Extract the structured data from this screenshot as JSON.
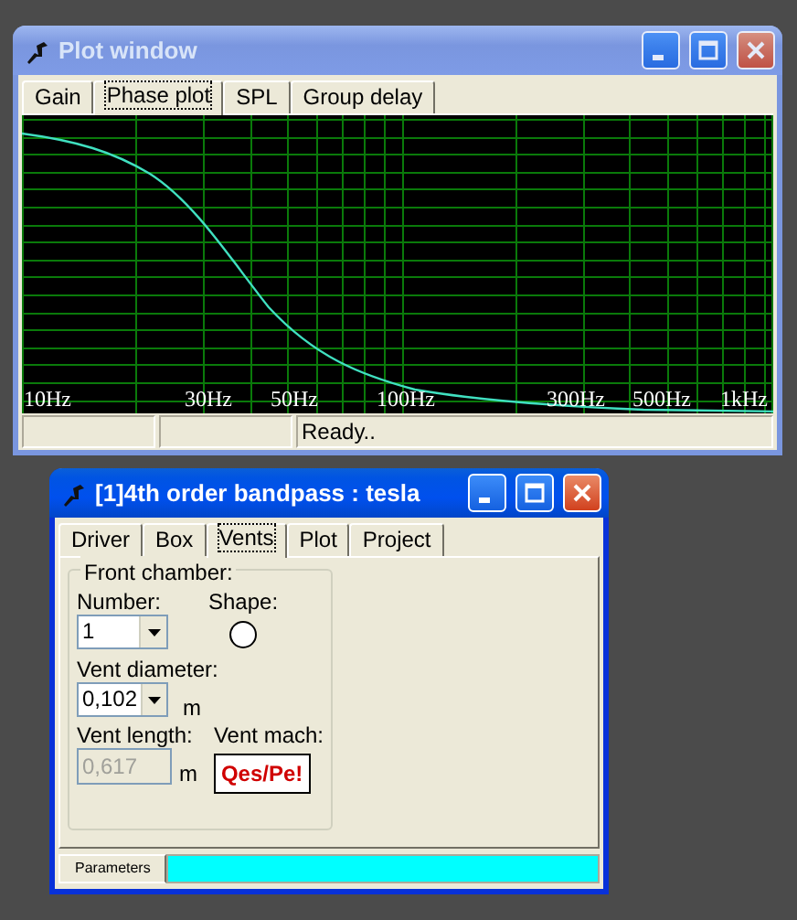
{
  "plot_window": {
    "title": "Plot window",
    "tabs": [
      {
        "label": "Gain",
        "selected": false
      },
      {
        "label": "Phase plot",
        "selected": true
      },
      {
        "label": "SPL",
        "selected": false
      },
      {
        "label": "Group delay",
        "selected": false
      }
    ],
    "x_labels": [
      "10Hz",
      "30Hz",
      "50Hz",
      "100Hz",
      "300Hz",
      "500Hz",
      "1kHz"
    ],
    "status_text": "Ready.."
  },
  "box_window": {
    "title": "[1]4th order bandpass : tesla",
    "tabs": [
      {
        "label": "Driver",
        "selected": false
      },
      {
        "label": "Box",
        "selected": false
      },
      {
        "label": "Vents",
        "selected": true
      },
      {
        "label": "Plot",
        "selected": false
      },
      {
        "label": "Project",
        "selected": false
      }
    ],
    "group": {
      "title": "Front chamber:",
      "number": {
        "label": "Number:",
        "value": "1"
      },
      "shape": {
        "label": "Shape:"
      },
      "vent_diameter": {
        "label": "Vent diameter:",
        "value": "0,102",
        "unit": "m"
      },
      "vent_length": {
        "label": "Vent length:",
        "value": "0,617",
        "unit": "m",
        "disabled": true
      },
      "vent_mach": {
        "label": "Vent mach:",
        "value": "Qes/Pe!"
      }
    },
    "bottom_tab": "Parameters",
    "progress": {
      "level": 1
    }
  }
}
